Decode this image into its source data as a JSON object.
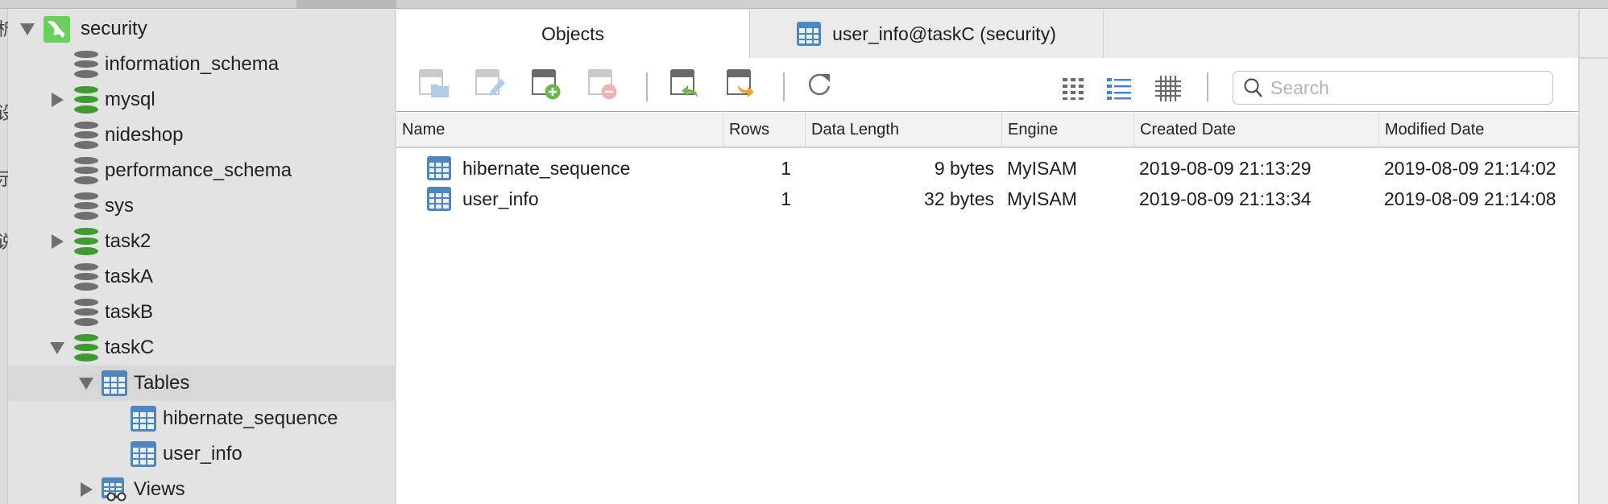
{
  "sidebar": {
    "connection": {
      "label": "security",
      "icon": "mysql-dolphin-icon",
      "expanded": true
    },
    "databases": [
      {
        "label": "information_schema",
        "state": "closed",
        "expandable": false
      },
      {
        "label": "mysql",
        "state": "open",
        "expandable": true,
        "expanded": false
      },
      {
        "label": "nideshop",
        "state": "closed",
        "expandable": false
      },
      {
        "label": "performance_schema",
        "state": "closed",
        "expandable": false
      },
      {
        "label": "sys",
        "state": "closed",
        "expandable": false
      },
      {
        "label": "task2",
        "state": "open",
        "expandable": true,
        "expanded": false
      },
      {
        "label": "taskA",
        "state": "closed",
        "expandable": false
      },
      {
        "label": "taskB",
        "state": "closed",
        "expandable": false
      },
      {
        "label": "taskC",
        "state": "open",
        "expandable": true,
        "expanded": true
      }
    ],
    "taskC_children": {
      "tables_label": "Tables",
      "tables": [
        "hibernate_sequence",
        "user_info"
      ],
      "views_label": "Views"
    }
  },
  "tabs": [
    {
      "label": "Objects",
      "active": true
    },
    {
      "label": "user_info@taskC (security)",
      "active": false,
      "icon": "table-icon"
    }
  ],
  "toolbar": {
    "buttons": [
      {
        "name": "open-table",
        "enabled": false
      },
      {
        "name": "design-table",
        "enabled": false
      },
      {
        "name": "new-table",
        "enabled": true
      },
      {
        "name": "delete-table",
        "enabled": false
      },
      {
        "name": "import-wizard",
        "enabled": true
      },
      {
        "name": "export-wizard",
        "enabled": true
      },
      {
        "name": "refresh",
        "enabled": true
      }
    ],
    "view_modes": [
      {
        "name": "icons-view",
        "active": false
      },
      {
        "name": "list-view",
        "active": true
      },
      {
        "name": "detail-view",
        "active": false
      }
    ],
    "search": {
      "placeholder": "Search",
      "value": ""
    }
  },
  "objects_table": {
    "columns": [
      "Name",
      "Rows",
      "Data Length",
      "Engine",
      "Created Date",
      "Modified Date"
    ],
    "rows": [
      {
        "name": "hibernate_sequence",
        "rows": "1",
        "data_length": "9 bytes",
        "engine": "MyISAM",
        "created": "2019-08-09 21:13:29",
        "modified": "2019-08-09 21:14:02"
      },
      {
        "name": "user_info",
        "rows": "1",
        "data_length": "32 bytes",
        "engine": "MyISAM",
        "created": "2019-08-09 21:13:34",
        "modified": "2019-08-09 21:14:08"
      }
    ]
  },
  "colors": {
    "accent_blue": "#3b82e0",
    "table_icon_blue": "#4f86bf",
    "db_open_green": "#3f9a30",
    "db_closed_gray": "#6f6f6f",
    "mysql_green": "#6bcf5e",
    "add_green": "#6cb84a",
    "import_green": "#6cb84a",
    "export_orange": "#f0a030",
    "delete_pink": "#f2b3b0"
  },
  "background_window_glyphs": [
    "析",
    "设",
    "示",
    "说"
  ]
}
